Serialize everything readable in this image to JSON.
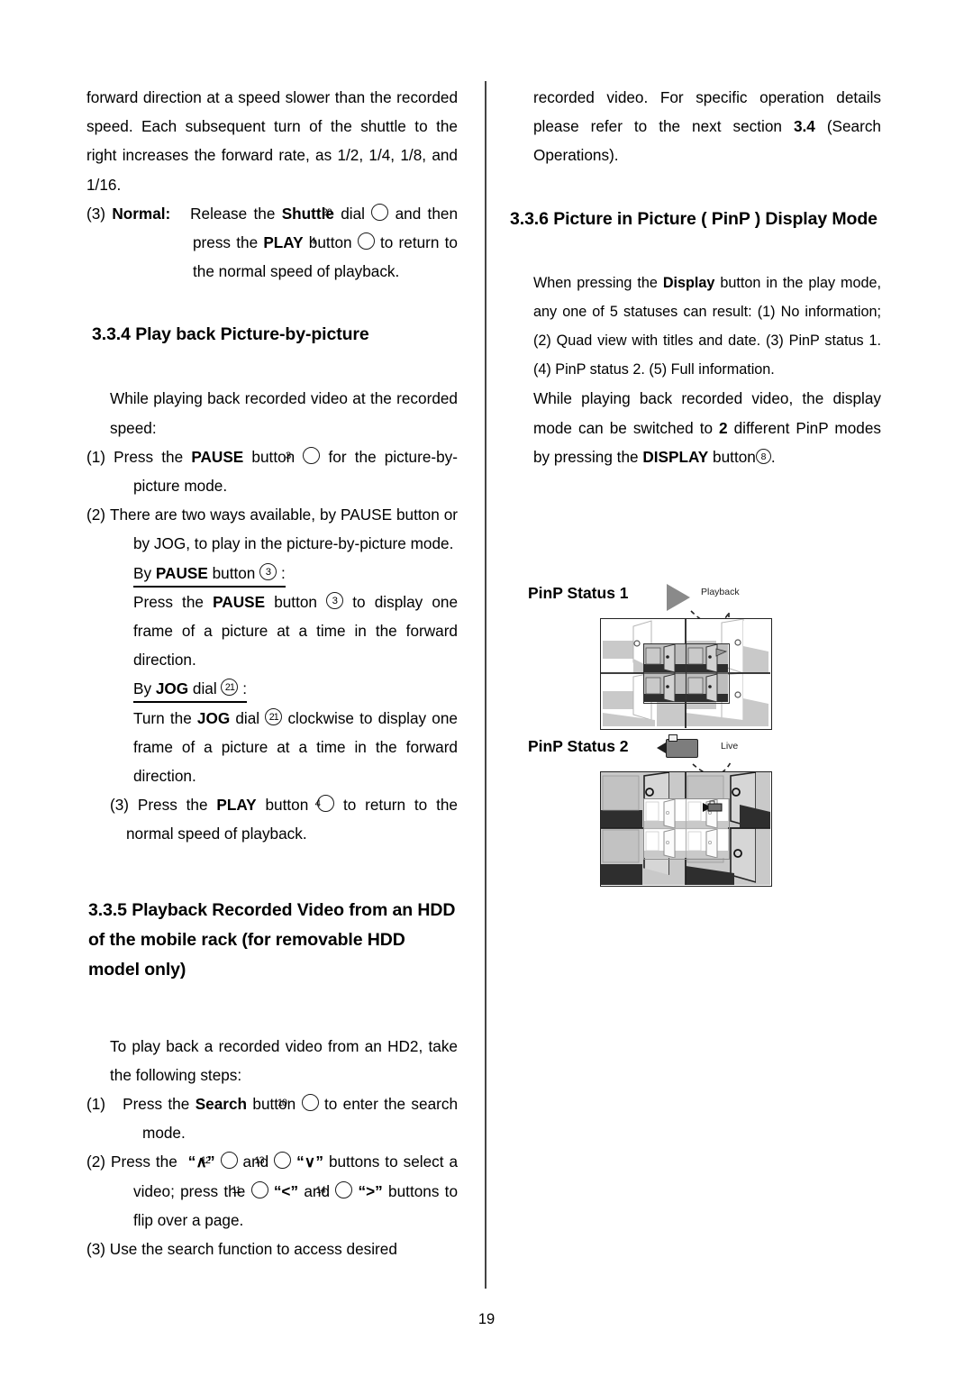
{
  "page": {
    "number": "19"
  },
  "left_column": {
    "para_continued": "forward direction at a speed slower than the recorded speed. Each subsequent turn of the shuttle to the right increases the forward rate, as 1/2, 1/4, 1/8, and 1/16.",
    "item3": {
      "marker": "(3)",
      "label": "Normal:",
      "text_a": "Release the",
      "bold_a": "Shuttle",
      "text_b": "dial",
      "circled_a": "20",
      "text_c": "and then press the",
      "bold_b": "PLAY",
      "text_d": "button",
      "circled_b": "4",
      "text_e": "to return to the normal speed of playback."
    },
    "heading_334": "3.3.4 Play back Picture-by-picture",
    "intro_334": "While playing back recorded video at the recorded speed:",
    "step1": {
      "marker": "(1)",
      "text_a": "Press the",
      "bold_a": "PAUSE",
      "text_b": "button",
      "circled": "3",
      "text_c": "for the picture-by-picture mode."
    },
    "step2": {
      "marker": "(2)",
      "text": "There are two ways available, by PAUSE button or by JOG, to play in the picture-by-picture mode."
    },
    "by_pause": {
      "text_a": "By",
      "bold_a": "PAUSE",
      "text_b": "button",
      "circled": "3",
      "text_c": ":"
    },
    "by_pause_body": {
      "text_a": "Press the",
      "bold_a": "PAUSE",
      "text_b": "button",
      "circled": "3",
      "text_c": "to display one frame of a picture at a time in the forward direction."
    },
    "by_jog": {
      "text_a": "By",
      "bold_a": "JOG",
      "text_b": "dial",
      "circled": "21",
      "text_c": ":"
    },
    "by_jog_body": {
      "text_a": "Turn the",
      "bold_a": "JOG",
      "text_b": "dial",
      "circled": "21",
      "text_c": "clockwise to display one frame of a picture at a time in the forward direction."
    },
    "step3": {
      "marker": "(3)",
      "text_a": "Press the",
      "bold_a": "PLAY",
      "text_b": "button",
      "circled": "4",
      "text_c": "to return to the normal speed of playback."
    },
    "heading_335": "3.3.5 Playback Recorded Video from an HDD of the mobile rack (for removable HDD model only)",
    "intro_335": "To play back a recorded video from an HD2, take the following steps:",
    "s5_step1": {
      "marker": "(1)",
      "text_a": "Press the",
      "bold_a": "Search",
      "text_b": "button",
      "circled": "10",
      "text_c": "to enter the search mode."
    },
    "s5_step2": {
      "marker": "(2)",
      "text_a": "Press the",
      "key_up": "“∧”",
      "circled_a": "12",
      "text_b": "and",
      "circled_b": "13",
      "key_down": "“∨”",
      "text_c": "buttons to select a video; press the",
      "circled_c": "11",
      "key_left": "“<”",
      "text_d": "and",
      "circled_d": "14",
      "key_right": "“>”",
      "text_e": "buttons to flip over a page."
    },
    "s5_step3": {
      "marker": "(3)",
      "text": "Use the search function to access desired"
    }
  },
  "right_column": {
    "para_continued_a": "recorded video. For specific operation details please refer to the next section",
    "para_continued_bold": "3.4",
    "para_continued_b": "(Search Operations).",
    "heading_336": "3.3.6 Picture in Picture ( PinP ) Display Mode",
    "para_display": {
      "text_a": "When pressing the",
      "bold_a": "Display",
      "text_b": "button in the play mode, any one of 5 statuses can result: (1) No information; (2) Quad view with titles and date. (3) PinP status 1. (4) PinP status 2. (5) Full information."
    },
    "para_modes": {
      "text_a": "While playing back recorded video, the display mode can be switched to",
      "bold_a": "2",
      "text_b": "different PinP modes by pressing the",
      "bold_b": "DISPLAY",
      "text_c": "button",
      "circled": "8",
      "text_d": "."
    },
    "figures": [
      {
        "label": "PinP Status 1",
        "source_label": "Playback",
        "source_icon": "play-triangle-icon"
      },
      {
        "label": "PinP Status 2",
        "source_label": "Live",
        "source_icon": "video-camera-icon"
      }
    ]
  },
  "colors": {
    "ink": "#000000",
    "divider": "#444444",
    "icon_gray": "#8a8a8a",
    "scene_wall": "#c8c8c8",
    "scene_floor_dark": "#333333",
    "scene_white": "#ffffff"
  }
}
